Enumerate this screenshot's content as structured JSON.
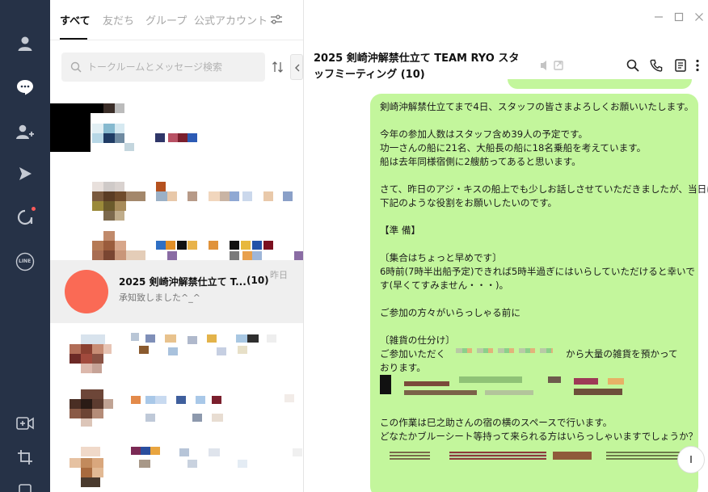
{
  "nav": {
    "items": [
      {
        "icon": "profile-icon"
      },
      {
        "icon": "chat-icon"
      },
      {
        "icon": "add-friend-icon"
      },
      {
        "icon": "voom-icon"
      },
      {
        "icon": "openchat-icon"
      },
      {
        "icon": "line-icon"
      },
      {
        "icon": "video-call-icon"
      },
      {
        "icon": "crop-icon"
      },
      {
        "icon": "settings-icon"
      }
    ],
    "line_label": "LINE"
  },
  "list": {
    "tabs": [
      {
        "label": "すべて"
      },
      {
        "label": "友だち"
      },
      {
        "label": "グループ"
      },
      {
        "label": "公式アカウント"
      }
    ],
    "search_placeholder": "トークルームとメッセージ検索",
    "selected_chat": {
      "name": "2025 剣崎沖解禁仕立て T...",
      "count": "(10)",
      "time": "昨日",
      "preview": "承知致しました^_^",
      "avatar_color": "#fa6a55"
    }
  },
  "chat": {
    "title": "2025 剣崎沖解禁仕立て TEAM RYO スタッフミーティング (10)",
    "bubble_color": "#c3f69c",
    "message_lines": [
      "剣崎沖解禁仕立てまで4日、スタッフの皆さまよろしくお願いいたします。",
      "",
      "今年の参加人数はスタッフ含め39人の予定です。",
      "功一さんの船に21名、大船長の船に18名乗船を考えています。",
      "船は去年同様宿側に2艘舫ってあると思います。",
      "",
      "さて、昨日のアジ・キスの船上でも少しお話しさせていただきましたが、当日は",
      "下記のような役割をお願いしたいのです。",
      "",
      "【準 備】",
      "",
      "〔集合はちょっと早めです〕",
      "6時前(7時半出船予定)できれば5時半過ぎにはいらしていただけると幸いで",
      "す(早くてすみません・・・)。",
      "",
      "ご参加の方々がいらっしゃる前に",
      "",
      "〔雑貨の仕分け〕",
      "ご参加いただく",
      "おります。",
      "",
      "",
      "",
      "この作業は巳之助さんの宿の横のスペースで行います。",
      "どなたかブルーシート等持って来られる方はいらっしゃいますでしょうか？"
    ],
    "line_suffix_18": "から大量の雑貨を預かって"
  }
}
